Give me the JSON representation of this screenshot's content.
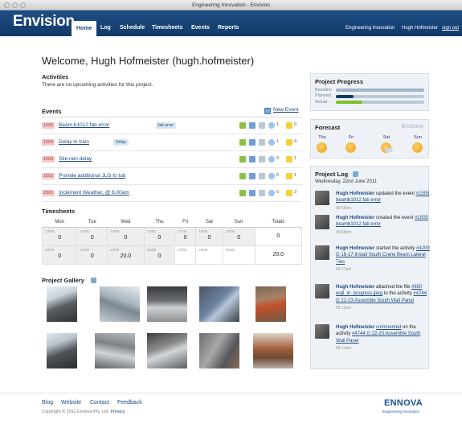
{
  "window": {
    "title": "Engineering Innovation - Envision"
  },
  "nav": {
    "logo": "Envision.",
    "items": [
      "Home",
      "Log",
      "Schedule",
      "Timesheets",
      "Events",
      "Reports"
    ],
    "org": "Engineering Innovation",
    "user": "Hugh Hofmeister",
    "signout": "sign out"
  },
  "welcome": "Welcome, Hugh Hofmeister (hugh.hofmeister)",
  "activities": {
    "title": "Activities",
    "text": "There are no upcoming activities for this project."
  },
  "events": {
    "title": "Events",
    "new_label": "New Event",
    "rows": [
      {
        "id": "1505",
        "title": "Beam b1012 fab error",
        "tag": "fab error",
        "comments": "1",
        "files": "0"
      },
      {
        "id": "1504",
        "title": "Delay in train",
        "tag": "Delay",
        "comments": "1",
        "files": "4"
      },
      {
        "id": "1503",
        "title": "Site rain delay",
        "tag": "",
        "comments": "0",
        "files": "1"
      },
      {
        "id": "1502",
        "title": "Provide additional JLG to tub",
        "tag": "",
        "comments": "0",
        "files": "1"
      },
      {
        "id": "1501",
        "title": "Inclement Weather, @ 6.00am",
        "tag": "",
        "comments": "0",
        "files": "3"
      }
    ]
  },
  "timesheets": {
    "title": "Timesheets",
    "days": [
      "Mon",
      "Tue",
      "Wed",
      "Thu",
      "Fri",
      "Sat",
      "Sun",
      "Totals"
    ],
    "weeks": [
      {
        "dates": [
          "13/06",
          "14/06",
          "15/06",
          "16/06",
          "17/06",
          "18/06",
          "19/06"
        ],
        "values": [
          "0",
          "0",
          "0",
          "0",
          "0",
          "0",
          "0"
        ],
        "total": "0"
      },
      {
        "dates": [
          "20/06",
          "21/06",
          "22/06",
          "23/06",
          "24/06",
          "25/06",
          "26/06"
        ],
        "values": [
          "0",
          "0",
          "20.0",
          "0",
          "",
          "",
          ""
        ],
        "total": "20.0"
      }
    ]
  },
  "gallery": {
    "title": "Project Gallery"
  },
  "progress": {
    "title": "Project Progress",
    "rows": [
      {
        "label": "Baseline",
        "value": 1.0,
        "color": "#9fb4c9"
      },
      {
        "label": "Planned",
        "value": 0.2,
        "color": "#123a68"
      },
      {
        "label": "Actual",
        "value": 0.3,
        "color": "#7fbf2a"
      }
    ]
  },
  "forecast": {
    "title": "Forecast",
    "city": "Brisbane",
    "days": [
      {
        "day": "Thu",
        "icon": "sun-icon"
      },
      {
        "day": "Fri",
        "icon": "sun-icon"
      },
      {
        "day": "Sat",
        "icon": "partly-cloudy-icon"
      },
      {
        "day": "Sun",
        "icon": "sun-icon"
      }
    ]
  },
  "log": {
    "title": "Project Log",
    "date": "Wednesday, 22nd June 2011",
    "entries": [
      {
        "user": "Hugh Hofmeister",
        "pre": "updated the event",
        "link": "#1505 beamb1012 fab error",
        "post": "",
        "time": "08:58am"
      },
      {
        "user": "Hugh Hofmeister",
        "pre": "created the event",
        "link": "#1505 beamb1012 fab error",
        "post": "",
        "time": "08:58am"
      },
      {
        "user": "Hugh Hofmeister",
        "pre": "started the activity",
        "link": "#4209 G 16-17:Install South Crane Beam Lateral Ties",
        "post": "",
        "time": "08:17am"
      },
      {
        "user": "Hugh Hofmeister",
        "pre": "attached the file",
        "link": "#650 wall_in_progress.jpeg",
        "post": "to the activity",
        "link2": "#4744 G 22-23:Assemble South Wall Panel",
        "time": "08:16am"
      },
      {
        "user": "Hugh Hofmeister",
        "pre": "",
        "link0": "commented",
        "mid": "on the activity",
        "link": "#4744 G 22-23:Assemble South Wall Panel",
        "post": "",
        "time": "08:14am"
      }
    ]
  },
  "footer": {
    "links": [
      "Blog",
      "Website",
      "Contact",
      "Feedback"
    ],
    "copyright": "Copyright © 2011 Ennova Pty. Ltd.",
    "privacy": "Privacy",
    "brand": "ENNOVA",
    "tagline": "Engineering Innovation"
  }
}
